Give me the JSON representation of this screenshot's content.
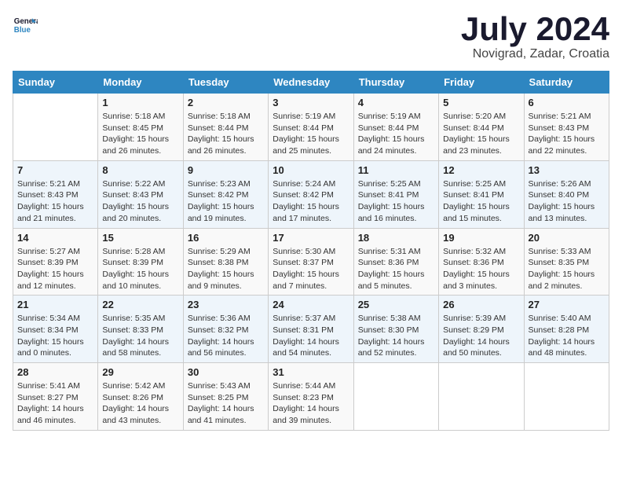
{
  "header": {
    "logo_line1": "General",
    "logo_line2": "Blue",
    "month": "July 2024",
    "location": "Novigrad, Zadar, Croatia"
  },
  "weekdays": [
    "Sunday",
    "Monday",
    "Tuesday",
    "Wednesday",
    "Thursday",
    "Friday",
    "Saturday"
  ],
  "weeks": [
    [
      {
        "day": "",
        "info": ""
      },
      {
        "day": "1",
        "info": "Sunrise: 5:18 AM\nSunset: 8:45 PM\nDaylight: 15 hours\nand 26 minutes."
      },
      {
        "day": "2",
        "info": "Sunrise: 5:18 AM\nSunset: 8:44 PM\nDaylight: 15 hours\nand 26 minutes."
      },
      {
        "day": "3",
        "info": "Sunrise: 5:19 AM\nSunset: 8:44 PM\nDaylight: 15 hours\nand 25 minutes."
      },
      {
        "day": "4",
        "info": "Sunrise: 5:19 AM\nSunset: 8:44 PM\nDaylight: 15 hours\nand 24 minutes."
      },
      {
        "day": "5",
        "info": "Sunrise: 5:20 AM\nSunset: 8:44 PM\nDaylight: 15 hours\nand 23 minutes."
      },
      {
        "day": "6",
        "info": "Sunrise: 5:21 AM\nSunset: 8:43 PM\nDaylight: 15 hours\nand 22 minutes."
      }
    ],
    [
      {
        "day": "7",
        "info": "Sunrise: 5:21 AM\nSunset: 8:43 PM\nDaylight: 15 hours\nand 21 minutes."
      },
      {
        "day": "8",
        "info": "Sunrise: 5:22 AM\nSunset: 8:43 PM\nDaylight: 15 hours\nand 20 minutes."
      },
      {
        "day": "9",
        "info": "Sunrise: 5:23 AM\nSunset: 8:42 PM\nDaylight: 15 hours\nand 19 minutes."
      },
      {
        "day": "10",
        "info": "Sunrise: 5:24 AM\nSunset: 8:42 PM\nDaylight: 15 hours\nand 17 minutes."
      },
      {
        "day": "11",
        "info": "Sunrise: 5:25 AM\nSunset: 8:41 PM\nDaylight: 15 hours\nand 16 minutes."
      },
      {
        "day": "12",
        "info": "Sunrise: 5:25 AM\nSunset: 8:41 PM\nDaylight: 15 hours\nand 15 minutes."
      },
      {
        "day": "13",
        "info": "Sunrise: 5:26 AM\nSunset: 8:40 PM\nDaylight: 15 hours\nand 13 minutes."
      }
    ],
    [
      {
        "day": "14",
        "info": "Sunrise: 5:27 AM\nSunset: 8:39 PM\nDaylight: 15 hours\nand 12 minutes."
      },
      {
        "day": "15",
        "info": "Sunrise: 5:28 AM\nSunset: 8:39 PM\nDaylight: 15 hours\nand 10 minutes."
      },
      {
        "day": "16",
        "info": "Sunrise: 5:29 AM\nSunset: 8:38 PM\nDaylight: 15 hours\nand 9 minutes."
      },
      {
        "day": "17",
        "info": "Sunrise: 5:30 AM\nSunset: 8:37 PM\nDaylight: 15 hours\nand 7 minutes."
      },
      {
        "day": "18",
        "info": "Sunrise: 5:31 AM\nSunset: 8:36 PM\nDaylight: 15 hours\nand 5 minutes."
      },
      {
        "day": "19",
        "info": "Sunrise: 5:32 AM\nSunset: 8:36 PM\nDaylight: 15 hours\nand 3 minutes."
      },
      {
        "day": "20",
        "info": "Sunrise: 5:33 AM\nSunset: 8:35 PM\nDaylight: 15 hours\nand 2 minutes."
      }
    ],
    [
      {
        "day": "21",
        "info": "Sunrise: 5:34 AM\nSunset: 8:34 PM\nDaylight: 15 hours\nand 0 minutes."
      },
      {
        "day": "22",
        "info": "Sunrise: 5:35 AM\nSunset: 8:33 PM\nDaylight: 14 hours\nand 58 minutes."
      },
      {
        "day": "23",
        "info": "Sunrise: 5:36 AM\nSunset: 8:32 PM\nDaylight: 14 hours\nand 56 minutes."
      },
      {
        "day": "24",
        "info": "Sunrise: 5:37 AM\nSunset: 8:31 PM\nDaylight: 14 hours\nand 54 minutes."
      },
      {
        "day": "25",
        "info": "Sunrise: 5:38 AM\nSunset: 8:30 PM\nDaylight: 14 hours\nand 52 minutes."
      },
      {
        "day": "26",
        "info": "Sunrise: 5:39 AM\nSunset: 8:29 PM\nDaylight: 14 hours\nand 50 minutes."
      },
      {
        "day": "27",
        "info": "Sunrise: 5:40 AM\nSunset: 8:28 PM\nDaylight: 14 hours\nand 48 minutes."
      }
    ],
    [
      {
        "day": "28",
        "info": "Sunrise: 5:41 AM\nSunset: 8:27 PM\nDaylight: 14 hours\nand 46 minutes."
      },
      {
        "day": "29",
        "info": "Sunrise: 5:42 AM\nSunset: 8:26 PM\nDaylight: 14 hours\nand 43 minutes."
      },
      {
        "day": "30",
        "info": "Sunrise: 5:43 AM\nSunset: 8:25 PM\nDaylight: 14 hours\nand 41 minutes."
      },
      {
        "day": "31",
        "info": "Sunrise: 5:44 AM\nSunset: 8:23 PM\nDaylight: 14 hours\nand 39 minutes."
      },
      {
        "day": "",
        "info": ""
      },
      {
        "day": "",
        "info": ""
      },
      {
        "day": "",
        "info": ""
      }
    ]
  ]
}
